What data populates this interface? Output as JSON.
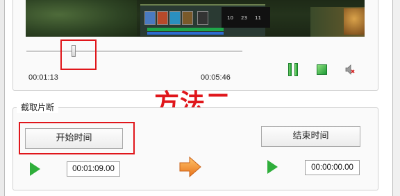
{
  "player": {
    "current_time": "00:01:13",
    "total_time": "00:05:46",
    "video_overlay": {
      "counter_a": "10",
      "counter_b": "23",
      "counter_c": "11"
    }
  },
  "annotation": "方法二",
  "clip": {
    "group_label": "截取片断",
    "start_button": "开始时间",
    "end_button": "结束时间",
    "start_time_value": "00:01:09.00",
    "end_time_value": "00:00:00.00"
  },
  "icons": {
    "pause": "pause-icon",
    "stop": "stop-icon",
    "mute": "speaker-muted-icon",
    "play": "play-icon",
    "arrow": "right-arrow-icon"
  },
  "colors": {
    "highlight": "#e0161b",
    "control_green": "#2fae3b",
    "arrow_orange": "#f18a1c"
  }
}
